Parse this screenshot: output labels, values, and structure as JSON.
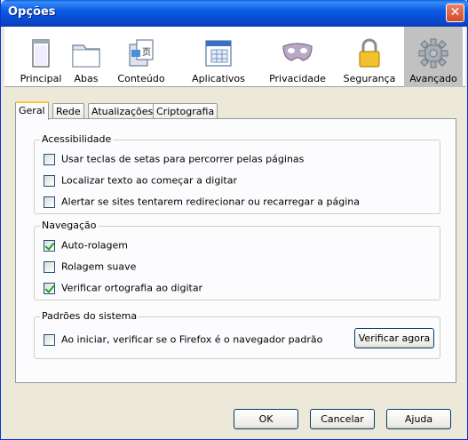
{
  "window": {
    "title": "Opções",
    "close_symbol": "✕"
  },
  "toolbar": {
    "items": [
      {
        "label": "Principal",
        "icon": "window-icon"
      },
      {
        "label": "Abas",
        "icon": "folder-tabs-icon"
      },
      {
        "label": "Conteúdo",
        "icon": "content-icon"
      },
      {
        "label": "Aplicativos",
        "icon": "applications-icon"
      },
      {
        "label": "Privacidade",
        "icon": "mask-icon"
      },
      {
        "label": "Segurança",
        "icon": "lock-icon"
      },
      {
        "label": "Avançado",
        "icon": "gear-icon",
        "selected": true
      }
    ]
  },
  "tabs": [
    {
      "label": "Geral",
      "active": true
    },
    {
      "label": "Rede"
    },
    {
      "label": "Atualizações"
    },
    {
      "label": "Criptografia"
    }
  ],
  "accessibility": {
    "title": "Acessibilidade",
    "options": [
      {
        "label": "Usar teclas de setas para percorrer pelas páginas",
        "checked": false
      },
      {
        "label": "Localizar texto ao começar a digitar",
        "checked": false
      },
      {
        "label": "Alertar se sites tentarem redirecionar ou recarregar a página",
        "checked": false
      }
    ]
  },
  "navigation": {
    "title": "Navegação",
    "options": [
      {
        "label": "Auto-rolagem",
        "checked": true
      },
      {
        "label": "Rolagem suave",
        "checked": false
      },
      {
        "label": "Verificar ortografia ao digitar",
        "checked": true
      }
    ]
  },
  "system_defaults": {
    "title": "Padrões do sistema",
    "option": {
      "label": "Ao iniciar, verificar se o Firefox é o navegador padrão",
      "checked": false
    },
    "check_now_label": "Verificar agora"
  },
  "footer": {
    "ok_label": "OK",
    "cancel_label": "Cancelar",
    "help_label": "Ajuda"
  },
  "colors": {
    "title_bar": "#0A5AE3",
    "dialog_bg": "#ECE9D8",
    "selected_toolbar": "#C1C1C1",
    "checkmark": "#21A121"
  }
}
